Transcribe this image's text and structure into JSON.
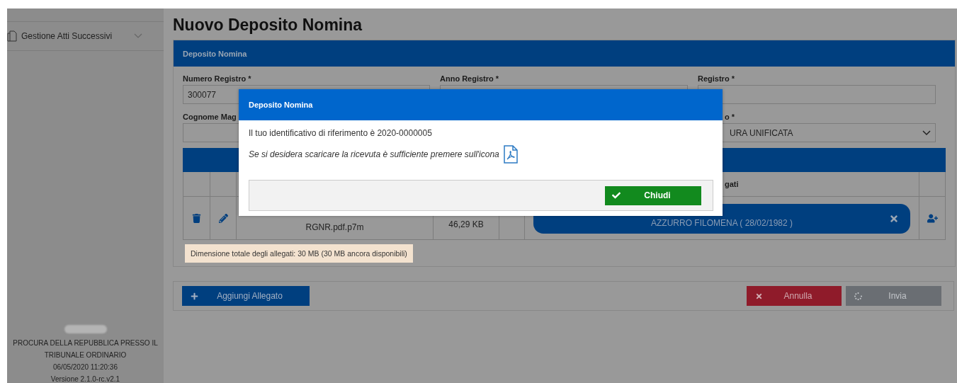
{
  "sidebar": {
    "items": [
      {
        "label": "Gestione Atti Successivi",
        "expanded": false
      }
    ],
    "footer": [
      "PROCURA DELLA REPUBBLICA PRESSO IL",
      "TRIBUNALE ORDINARIO",
      "06/05/2020 11:20:36",
      "Versione 2.1.0-rc.v2.1"
    ]
  },
  "page_title": "Nuovo Deposito Nomina",
  "panel": {
    "title": "Deposito Nomina",
    "fields": [
      {
        "label": "Numero Registro *",
        "value": "300077",
        "kind": "text"
      },
      {
        "label": "Anno Registro *",
        "kind": "text"
      },
      {
        "label": "Registro *",
        "kind": "text"
      },
      {
        "label": "Cognome Mag",
        "kind": "text"
      },
      {
        "label": "o *",
        "value": "URA UNIFICATA",
        "kind": "select"
      }
    ],
    "attachments": {
      "column_header": "gati",
      "rows": [
        {
          "file": "RGNR.pdf.p7m",
          "size": "46,29 KB",
          "person": "AZZURRO FILOMENA ( 28/02/1982 )"
        }
      ]
    },
    "note": "Dimensione totale degli allegati: 30 MB (30 MB ancora disponibili)"
  },
  "actions": [
    {
      "label": "Aggiungi Allegato",
      "kind": "add"
    },
    {
      "label": "Annulla",
      "kind": "cancel"
    },
    {
      "label": "Invia",
      "kind": "send",
      "disabled": true
    }
  ],
  "dialog": {
    "title": "Deposito Nomina",
    "message": "Il tuo identificativo di riferimento è 2020-0000005",
    "hint": "Se si desidera scaricare la ricevuta è sufficiente premere sull'icona",
    "button": "Chiudi"
  }
}
